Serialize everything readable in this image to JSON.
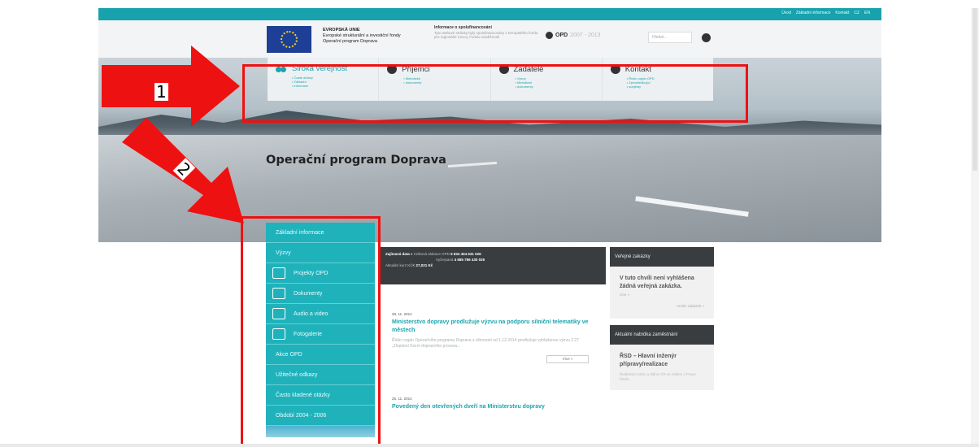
{
  "topbar": {
    "links": [
      "Úvod",
      "Základní informace",
      "Kontakt",
      "CZ",
      "EN"
    ]
  },
  "header": {
    "eu_lines": [
      "EVROPSKÁ UNIE",
      "Evropské strukturální a investiční fondy",
      "Operační program Doprava"
    ],
    "info_title": "Informace o spolufinancování",
    "info_text": "Tyto webové stránky byly spolufinancovány z Evropského fondu pro regionální rozvoj, Fondu soudržnosti",
    "opd_label": "OPD",
    "opd_years": "2007 - 2013",
    "search_placeholder": "Hledat..."
  },
  "nav": {
    "items": [
      {
        "label": "Široká veřejnost",
        "subs": [
          "Časté dotazy",
          "Základní",
          "informace"
        ]
      },
      {
        "label": "Příjemci",
        "subs": [
          "Metodické",
          "dokumenty"
        ]
      },
      {
        "label": "Žadatelé",
        "subs": [
          "Výzvy",
          "Metodické",
          "dokumenty"
        ]
      },
      {
        "label": "Kontakt",
        "subs": [
          "Řídicí orgán OPD",
          "Zprostředkující",
          "subjekty"
        ]
      }
    ]
  },
  "hero_title": "Operační program Doprava",
  "annotations": {
    "label1": "1",
    "label2": "2",
    "color": "#ee1111"
  },
  "sidebar": {
    "items": [
      "Základní informace",
      "Výzvy",
      "Projekty OPD",
      "Dokumenty",
      "Audio a video",
      "Fotogalerie",
      "Akce OPD",
      "Užitečné odkazy",
      "Často kladené otázky",
      "Období 2004 - 2006"
    ]
  },
  "news": {
    "head_line1_label": "Zajímavá data »",
    "head_line1_a": "Celková alokace OPD",
    "head_line1_value": "5 834 404 631 026",
    "head_line2_a": "Vyčerpaná",
    "head_line2_value": "4 685 786 430 026",
    "head_line3_a": "Aktuální kurz Kč/€",
    "head_line3_value": "27,021 Kč",
    "items": [
      {
        "date": "28. 11. 2014",
        "title": "Ministerstvo dopravy prodlužuje výzvu na podporu silniční telematiky ve městech",
        "text": "Řídicí orgán Operačního programu Doprava s účinností od 1.12.2014 prodlužuje vyhlášenou výzvu 2.27 „Zlepšení řízení dopravního procesu...",
        "more": "Více »"
      },
      {
        "date": "25. 11. 2014",
        "title": "Povedený den otevřených dveří na Ministerstvu dopravy",
        "text": "",
        "more": ""
      }
    ]
  },
  "right": {
    "box1_title": "Veřejné zakázky",
    "box1_text": "V tuto chvíli není vyhlášena žádná veřejná zakázka.",
    "box1_small": "více »",
    "box1_link": "Archiv zakázek »",
    "box2_title": "Aktuální nabídka zaměstnání",
    "box2_text": "ŘSD – Hlavní inženýr přípravy/realizace",
    "box2_desc": "Ředitelství silnic a dálnic ČR se sídlem v Praze hledá ..."
  }
}
